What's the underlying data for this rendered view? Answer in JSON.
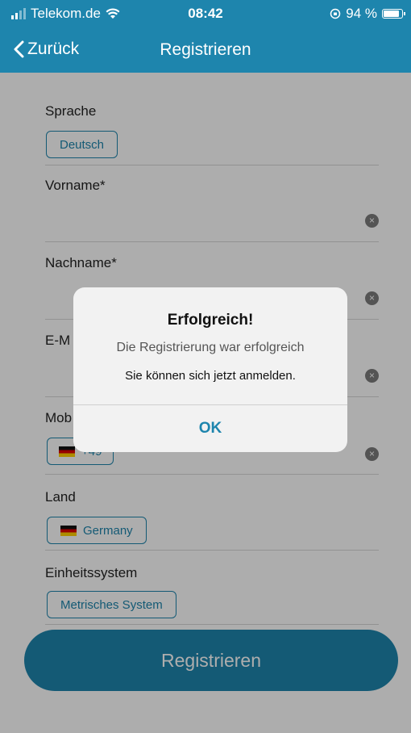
{
  "status_bar": {
    "carrier": "Telekom.de",
    "time": "08:42",
    "battery": "94 %"
  },
  "nav": {
    "back_label": "Zurück",
    "title": "Registrieren"
  },
  "form": {
    "language_label": "Sprache",
    "language_value": "Deutsch",
    "firstname_label": "Vorname",
    "lastname_label": "Nachname",
    "required_mark": "*",
    "email_label": "E-M",
    "mobile_label": "Mob",
    "mobile_prefix": "+49",
    "country_label": "Land",
    "country_value": "Germany",
    "units_label": "Einheitssystem",
    "units_value": "Metrisches System",
    "submit_label": "Registrieren"
  },
  "dialog": {
    "title": "Erfolgreich!",
    "subtitle": "Die Registrierung war erfolgreich",
    "message": "Sie können sich jetzt anmelden.",
    "ok_label": "OK"
  },
  "colors": {
    "accent": "#1e85ad",
    "required": "#d0021b"
  }
}
